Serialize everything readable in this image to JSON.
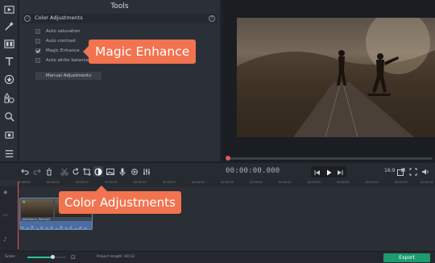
{
  "tools_panel": {
    "title": "Tools",
    "section_title": "Color Adjustments",
    "options": [
      {
        "label": "Auto saturation",
        "checked": false
      },
      {
        "label": "Auto contrast",
        "checked": false
      },
      {
        "label": "Magic Enhance",
        "checked": true
      },
      {
        "label": "Auto white balance",
        "checked": false
      }
    ],
    "manual_button": "Manual Adjustments"
  },
  "callouts": {
    "magic": "Magic Enhance",
    "color": "Color Adjustments"
  },
  "player": {
    "timecode": "00:00:00.000",
    "aspect": "16:9"
  },
  "timeline": {
    "ticks": [
      "00:00:00",
      "00:00:05",
      "00:00:10",
      "00:00:15",
      "00:00:20",
      "00:00:25",
      "00:00:30",
      "00:00:35",
      "00:00:40",
      "00:00:45",
      "00:00:50",
      "00:00:55",
      "00:01:00",
      "00:01:05",
      "00:01:10"
    ],
    "clip_name": "adventure_file.mp4"
  },
  "status": {
    "scale_label": "Scale:",
    "scale_value": 0.65,
    "project_length": "Project length: 00:12",
    "export_label": "Export"
  },
  "icons": {
    "left_tools": [
      "film-import-icon",
      "magic-wand-icon",
      "filters-icon",
      "title-text-icon",
      "sticker-icon",
      "shapes-icon",
      "zoom-icon",
      "stabilization-icon",
      "more-menu-icon"
    ],
    "colors": {
      "accent": "#f2734f",
      "export": "#1e9a6f",
      "playhead": "#e05a5a"
    }
  }
}
